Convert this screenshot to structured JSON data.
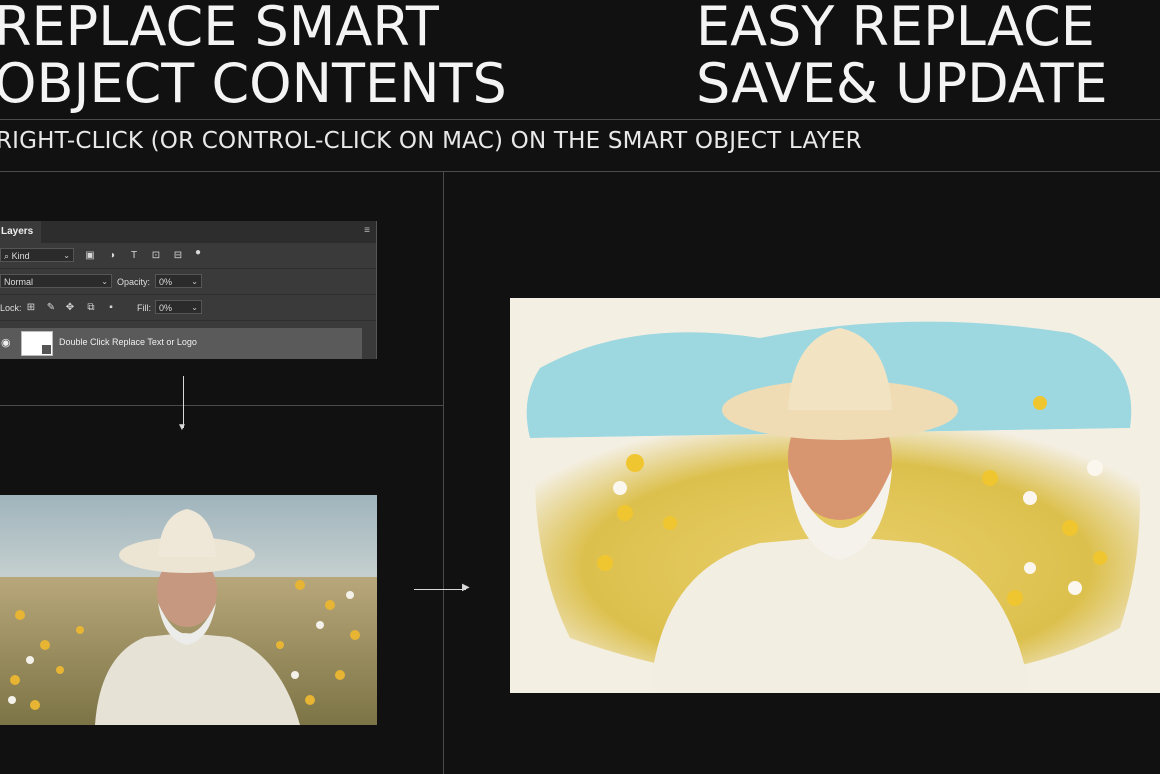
{
  "headline_left": [
    "REPLACE SMART",
    "OBJECT CONTENTS"
  ],
  "headline_right": [
    "EASY REPLACE",
    "SAVE& UPDATE"
  ],
  "subtitle": "RIGHT-CLICK (OR CONTROL-CLICK ON MAC) ON THE SMART OBJECT LAYER",
  "layers_panel": {
    "tab_label": "Layers",
    "menu_icon": "panel-menu-icon",
    "filter": {
      "search_icon": "search-icon",
      "kind_value": "Kind",
      "filter_icons": [
        "image-filter-icon",
        "adjustment-filter-icon",
        "type-filter-icon",
        "shape-filter-icon",
        "smart-object-filter-icon",
        "filter-toggle-icon"
      ]
    },
    "blend_mode": "Normal",
    "opacity_label": "Opacity:",
    "opacity_value": "0%",
    "lock_label": "Lock:",
    "lock_icons": [
      "lock-transparent-icon",
      "lock-paint-icon",
      "lock-position-icon",
      "lock-artboard-icon",
      "lock-all-icon"
    ],
    "fill_label": "Fill:",
    "fill_value": "0%",
    "layer": {
      "visibility_icon": "eye-icon",
      "name": "Double Click Replace Text or Logo"
    }
  },
  "colors": {
    "background": "#111111",
    "text": "#f2f2f2",
    "divider": "#4a4a4a",
    "panel": "#3a3a3a",
    "selected_layer": "#5a5a5a"
  }
}
